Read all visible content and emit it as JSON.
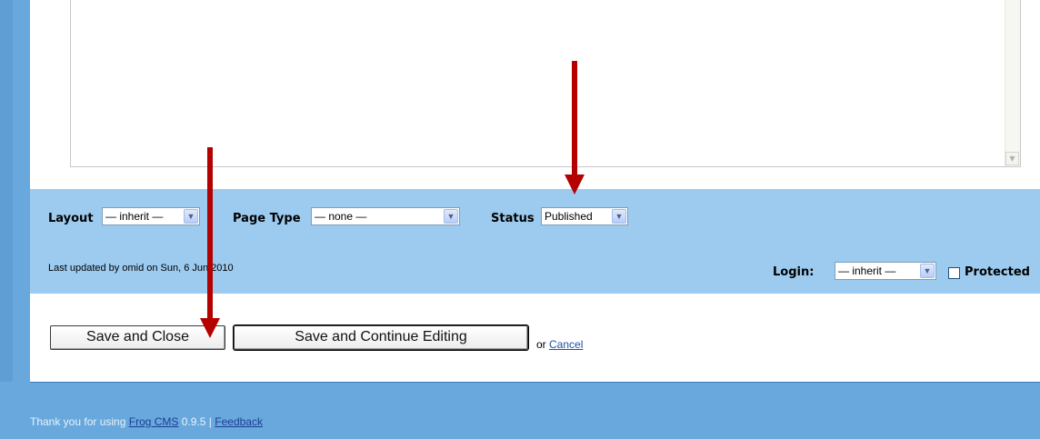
{
  "options": {
    "layout_label": "Layout",
    "layout_value": "— inherit —",
    "page_type_label": "Page Type",
    "page_type_value": "— none —",
    "status_label": "Status",
    "status_value": "Published",
    "last_updated": "Last updated by omid on Sun, 6 Jun 2010",
    "login_label": "Login:",
    "login_value": "— inherit —",
    "protected_label": "Protected",
    "protected_checked": false
  },
  "actions": {
    "save_close_label": "Save and Close",
    "save_continue_label": "Save and Continue Editing",
    "or_text": "or",
    "cancel_label": "Cancel"
  },
  "footer": {
    "prefix": "Thank you for using",
    "app_link": "Frog CMS",
    "version": "0.9.5 |",
    "feedback_link": "Feedback"
  },
  "colors": {
    "options_bar": "#9ccbef",
    "page_bg": "#68a8dc",
    "annotation_arrow": "#b40000"
  },
  "icons": {
    "dropdown": "chevron-down-icon",
    "editor_scroll_down": "scroll-down-arrow-icon",
    "annotation": "red-down-arrow-icon"
  }
}
